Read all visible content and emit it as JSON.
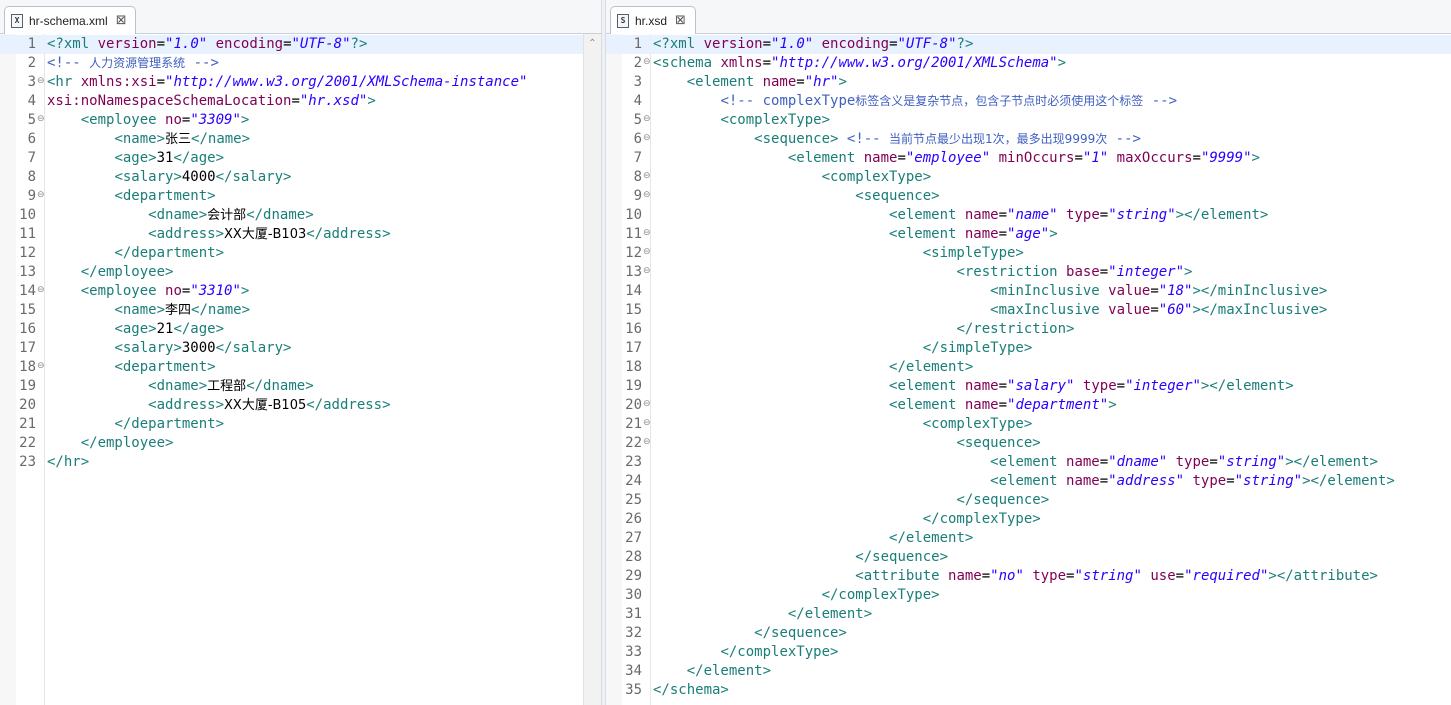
{
  "left": {
    "tab": {
      "icon": "X",
      "title": "hr-schema.xml"
    },
    "lines": [
      [
        [
          "pi",
          "<?xml "
        ],
        [
          "attr",
          "version"
        ],
        [
          "txt",
          "="
        ],
        [
          "val",
          "\"1.0\""
        ],
        [
          "txt",
          " "
        ],
        [
          "attr",
          "encoding"
        ],
        [
          "txt",
          "="
        ],
        [
          "val",
          "\"UTF-8\""
        ],
        [
          "pi",
          "?>"
        ]
      ],
      [
        [
          "com",
          "<!-- "
        ],
        [
          "comtext",
          "人力资源管理系统"
        ],
        [
          "com",
          " -->"
        ]
      ],
      [
        [
          "tag",
          "<hr "
        ],
        [
          "attr",
          "xmlns:xsi"
        ],
        [
          "txt",
          "="
        ],
        [
          "val",
          "\"http://www.w3.org/2001/XMLSchema-instance\""
        ]
      ],
      [
        [
          "attr",
          "xsi:noNamespaceSchemaLocation"
        ],
        [
          "txt",
          "="
        ],
        [
          "val",
          "\"hr.xsd\""
        ],
        [
          "tag",
          ">"
        ]
      ],
      [
        [
          "txt",
          "    "
        ],
        [
          "tag",
          "<employee "
        ],
        [
          "attr",
          "no"
        ],
        [
          "txt",
          "="
        ],
        [
          "val",
          "\"3309\""
        ],
        [
          "tag",
          ">"
        ]
      ],
      [
        [
          "txt",
          "        "
        ],
        [
          "tag",
          "<name>"
        ],
        [
          "cjk",
          "张三"
        ],
        [
          "tag",
          "</name>"
        ]
      ],
      [
        [
          "txt",
          "        "
        ],
        [
          "tag",
          "<age>"
        ],
        [
          "txt",
          "31"
        ],
        [
          "tag",
          "</age>"
        ]
      ],
      [
        [
          "txt",
          "        "
        ],
        [
          "tag",
          "<salary>"
        ],
        [
          "txt",
          "4000"
        ],
        [
          "tag",
          "</salary>"
        ]
      ],
      [
        [
          "txt",
          "        "
        ],
        [
          "tag",
          "<department>"
        ]
      ],
      [
        [
          "txt",
          "            "
        ],
        [
          "tag",
          "<dname>"
        ],
        [
          "cjk",
          "会计部"
        ],
        [
          "tag",
          "</dname>"
        ]
      ],
      [
        [
          "txt",
          "            "
        ],
        [
          "tag",
          "<address>"
        ],
        [
          "cjk",
          "XX大厦-B103"
        ],
        [
          "tag",
          "</address>"
        ]
      ],
      [
        [
          "txt",
          "        "
        ],
        [
          "tag",
          "</department>"
        ]
      ],
      [
        [
          "txt",
          "    "
        ],
        [
          "tag",
          "</employee>"
        ]
      ],
      [
        [
          "txt",
          "    "
        ],
        [
          "tag",
          "<employee "
        ],
        [
          "attr",
          "no"
        ],
        [
          "txt",
          "="
        ],
        [
          "val",
          "\"3310\""
        ],
        [
          "tag",
          ">"
        ]
      ],
      [
        [
          "txt",
          "        "
        ],
        [
          "tag",
          "<name>"
        ],
        [
          "cjk",
          "李四"
        ],
        [
          "tag",
          "</name>"
        ]
      ],
      [
        [
          "txt",
          "        "
        ],
        [
          "tag",
          "<age>"
        ],
        [
          "txt",
          "21"
        ],
        [
          "tag",
          "</age>"
        ]
      ],
      [
        [
          "txt",
          "        "
        ],
        [
          "tag",
          "<salary>"
        ],
        [
          "txt",
          "3000"
        ],
        [
          "tag",
          "</salary>"
        ]
      ],
      [
        [
          "txt",
          "        "
        ],
        [
          "tag",
          "<department>"
        ]
      ],
      [
        [
          "txt",
          "            "
        ],
        [
          "tag",
          "<dname>"
        ],
        [
          "cjk",
          "工程部"
        ],
        [
          "tag",
          "</dname>"
        ]
      ],
      [
        [
          "txt",
          "            "
        ],
        [
          "tag",
          "<address>"
        ],
        [
          "cjk",
          "XX大厦-B105"
        ],
        [
          "tag",
          "</address>"
        ]
      ],
      [
        [
          "txt",
          "        "
        ],
        [
          "tag",
          "</department>"
        ]
      ],
      [
        [
          "txt",
          "    "
        ],
        [
          "tag",
          "</employee>"
        ]
      ],
      [
        [
          "tag",
          "</hr>"
        ]
      ]
    ],
    "line_numbers": [
      "1",
      "2",
      "3",
      "4",
      "5",
      "6",
      "7",
      "8",
      "9",
      "10",
      "11",
      "12",
      "13",
      "14",
      "15",
      "16",
      "17",
      "18",
      "19",
      "20",
      "21",
      "22",
      "23"
    ],
    "fold_lines": [
      3,
      5,
      9,
      14,
      18
    ]
  },
  "right": {
    "tab": {
      "icon": "S",
      "title": "hr.xsd"
    },
    "lines": [
      [
        [
          "pi",
          "<?xml "
        ],
        [
          "attr",
          "version"
        ],
        [
          "txt",
          "="
        ],
        [
          "val",
          "\"1.0\""
        ],
        [
          "txt",
          " "
        ],
        [
          "attr",
          "encoding"
        ],
        [
          "txt",
          "="
        ],
        [
          "val",
          "\"UTF-8\""
        ],
        [
          "pi",
          "?>"
        ]
      ],
      [
        [
          "tag",
          "<schema "
        ],
        [
          "attr",
          "xmlns"
        ],
        [
          "txt",
          "="
        ],
        [
          "val",
          "\"http://www.w3.org/2001/XMLSchema\""
        ],
        [
          "tag",
          ">"
        ]
      ],
      [
        [
          "txt",
          "    "
        ],
        [
          "tag",
          "<element "
        ],
        [
          "attr",
          "name"
        ],
        [
          "txt",
          "="
        ],
        [
          "val",
          "\"hr\""
        ],
        [
          "tag",
          ">"
        ]
      ],
      [
        [
          "txt",
          "        "
        ],
        [
          "com",
          "<!-- complexType"
        ],
        [
          "comtext",
          "标签含义是复杂节点，包含子节点时必须使用这个标签"
        ],
        [
          "com",
          " -->"
        ]
      ],
      [
        [
          "txt",
          "        "
        ],
        [
          "tag",
          "<complexType>"
        ]
      ],
      [
        [
          "txt",
          "            "
        ],
        [
          "tag",
          "<sequence>"
        ],
        [
          "txt",
          " "
        ],
        [
          "com",
          "<!-- "
        ],
        [
          "comtext",
          "当前节点最少出现1次，最多出现9999次"
        ],
        [
          "com",
          " -->"
        ]
      ],
      [
        [
          "txt",
          "                "
        ],
        [
          "tag",
          "<element "
        ],
        [
          "attr",
          "name"
        ],
        [
          "txt",
          "="
        ],
        [
          "val",
          "\"employee\""
        ],
        [
          "txt",
          " "
        ],
        [
          "attr",
          "minOccurs"
        ],
        [
          "txt",
          "="
        ],
        [
          "val",
          "\"1\""
        ],
        [
          "txt",
          " "
        ],
        [
          "attr",
          "maxOccurs"
        ],
        [
          "txt",
          "="
        ],
        [
          "val",
          "\"9999\""
        ],
        [
          "tag",
          ">"
        ]
      ],
      [
        [
          "txt",
          "                    "
        ],
        [
          "tag",
          "<complexType>"
        ]
      ],
      [
        [
          "txt",
          "                        "
        ],
        [
          "tag",
          "<sequence>"
        ]
      ],
      [
        [
          "txt",
          "                            "
        ],
        [
          "tag",
          "<element "
        ],
        [
          "attr",
          "name"
        ],
        [
          "txt",
          "="
        ],
        [
          "val",
          "\"name\""
        ],
        [
          "txt",
          " "
        ],
        [
          "attr",
          "type"
        ],
        [
          "txt",
          "="
        ],
        [
          "val",
          "\"string\""
        ],
        [
          "tag",
          "></element>"
        ]
      ],
      [
        [
          "txt",
          "                            "
        ],
        [
          "tag",
          "<element "
        ],
        [
          "attr",
          "name"
        ],
        [
          "txt",
          "="
        ],
        [
          "val",
          "\"age\""
        ],
        [
          "tag",
          ">"
        ]
      ],
      [
        [
          "txt",
          "                                "
        ],
        [
          "tag",
          "<simpleType>"
        ]
      ],
      [
        [
          "txt",
          "                                    "
        ],
        [
          "tag",
          "<restriction "
        ],
        [
          "attr",
          "base"
        ],
        [
          "txt",
          "="
        ],
        [
          "val",
          "\"integer\""
        ],
        [
          "tag",
          ">"
        ]
      ],
      [
        [
          "txt",
          "                                        "
        ],
        [
          "tag",
          "<minInclusive "
        ],
        [
          "attr",
          "value"
        ],
        [
          "txt",
          "="
        ],
        [
          "val",
          "\"18\""
        ],
        [
          "tag",
          "></minInclusive>"
        ]
      ],
      [
        [
          "txt",
          "                                        "
        ],
        [
          "tag",
          "<maxInclusive "
        ],
        [
          "attr",
          "value"
        ],
        [
          "txt",
          "="
        ],
        [
          "val",
          "\"60\""
        ],
        [
          "tag",
          "></maxInclusive>"
        ]
      ],
      [
        [
          "txt",
          "                                    "
        ],
        [
          "tag",
          "</restriction>"
        ]
      ],
      [
        [
          "txt",
          "                                "
        ],
        [
          "tag",
          "</simpleType>"
        ]
      ],
      [
        [
          "txt",
          "                            "
        ],
        [
          "tag",
          "</element>"
        ]
      ],
      [
        [
          "txt",
          "                            "
        ],
        [
          "tag",
          "<element "
        ],
        [
          "attr",
          "name"
        ],
        [
          "txt",
          "="
        ],
        [
          "val",
          "\"salary\""
        ],
        [
          "txt",
          " "
        ],
        [
          "attr",
          "type"
        ],
        [
          "txt",
          "="
        ],
        [
          "val",
          "\"integer\""
        ],
        [
          "tag",
          "></element>"
        ]
      ],
      [
        [
          "txt",
          "                            "
        ],
        [
          "tag",
          "<element "
        ],
        [
          "attr",
          "name"
        ],
        [
          "txt",
          "="
        ],
        [
          "val",
          "\"department\""
        ],
        [
          "tag",
          ">"
        ]
      ],
      [
        [
          "txt",
          "                                "
        ],
        [
          "tag",
          "<complexType>"
        ]
      ],
      [
        [
          "txt",
          "                                    "
        ],
        [
          "tag",
          "<sequence>"
        ]
      ],
      [
        [
          "txt",
          "                                        "
        ],
        [
          "tag",
          "<element "
        ],
        [
          "attr",
          "name"
        ],
        [
          "txt",
          "="
        ],
        [
          "val",
          "\"dname\""
        ],
        [
          "txt",
          " "
        ],
        [
          "attr",
          "type"
        ],
        [
          "txt",
          "="
        ],
        [
          "val",
          "\"string\""
        ],
        [
          "tag",
          "></element>"
        ]
      ],
      [
        [
          "txt",
          "                                        "
        ],
        [
          "tag",
          "<element "
        ],
        [
          "attr",
          "name"
        ],
        [
          "txt",
          "="
        ],
        [
          "val",
          "\"address\""
        ],
        [
          "txt",
          " "
        ],
        [
          "attr",
          "type"
        ],
        [
          "txt",
          "="
        ],
        [
          "val",
          "\"string\""
        ],
        [
          "tag",
          "></element>"
        ]
      ],
      [
        [
          "txt",
          "                                    "
        ],
        [
          "tag",
          "</sequence>"
        ]
      ],
      [
        [
          "txt",
          "                                "
        ],
        [
          "tag",
          "</complexType>"
        ]
      ],
      [
        [
          "txt",
          "                            "
        ],
        [
          "tag",
          "</element>"
        ]
      ],
      [
        [
          "txt",
          "                        "
        ],
        [
          "tag",
          "</sequence>"
        ]
      ],
      [
        [
          "txt",
          "                        "
        ],
        [
          "tag",
          "<attribute "
        ],
        [
          "attr",
          "name"
        ],
        [
          "txt",
          "="
        ],
        [
          "val",
          "\"no\""
        ],
        [
          "txt",
          " "
        ],
        [
          "attr",
          "type"
        ],
        [
          "txt",
          "="
        ],
        [
          "val",
          "\"string\""
        ],
        [
          "txt",
          " "
        ],
        [
          "attr",
          "use"
        ],
        [
          "txt",
          "="
        ],
        [
          "val",
          "\"required\""
        ],
        [
          "tag",
          "></attribute>"
        ]
      ],
      [
        [
          "txt",
          "                    "
        ],
        [
          "tag",
          "</complexType>"
        ]
      ],
      [
        [
          "txt",
          "                "
        ],
        [
          "tag",
          "</element>"
        ]
      ],
      [
        [
          "txt",
          "            "
        ],
        [
          "tag",
          "</sequence>"
        ]
      ],
      [
        [
          "txt",
          "        "
        ],
        [
          "tag",
          "</complexType>"
        ]
      ],
      [
        [
          "txt",
          "    "
        ],
        [
          "tag",
          "</element>"
        ]
      ],
      [
        [
          "tag",
          "</schema>"
        ]
      ]
    ],
    "line_numbers": [
      "1",
      "2",
      "3",
      "4",
      "5",
      "6",
      "7",
      "8",
      "9",
      "10",
      "11",
      "12",
      "13",
      "14",
      "15",
      "16",
      "17",
      "18",
      "19",
      "20",
      "21",
      "22",
      "23",
      "24",
      "25",
      "26",
      "27",
      "28",
      "29",
      "30",
      "31",
      "32",
      "33",
      "34",
      "35"
    ],
    "fold_lines": [
      2,
      5,
      6,
      8,
      9,
      11,
      12,
      13,
      20,
      21,
      22
    ]
  },
  "icons": {
    "close": "close-icon",
    "fold": "fold-collapse-icon",
    "scroll_up": "scroll-up-arrow-icon"
  }
}
